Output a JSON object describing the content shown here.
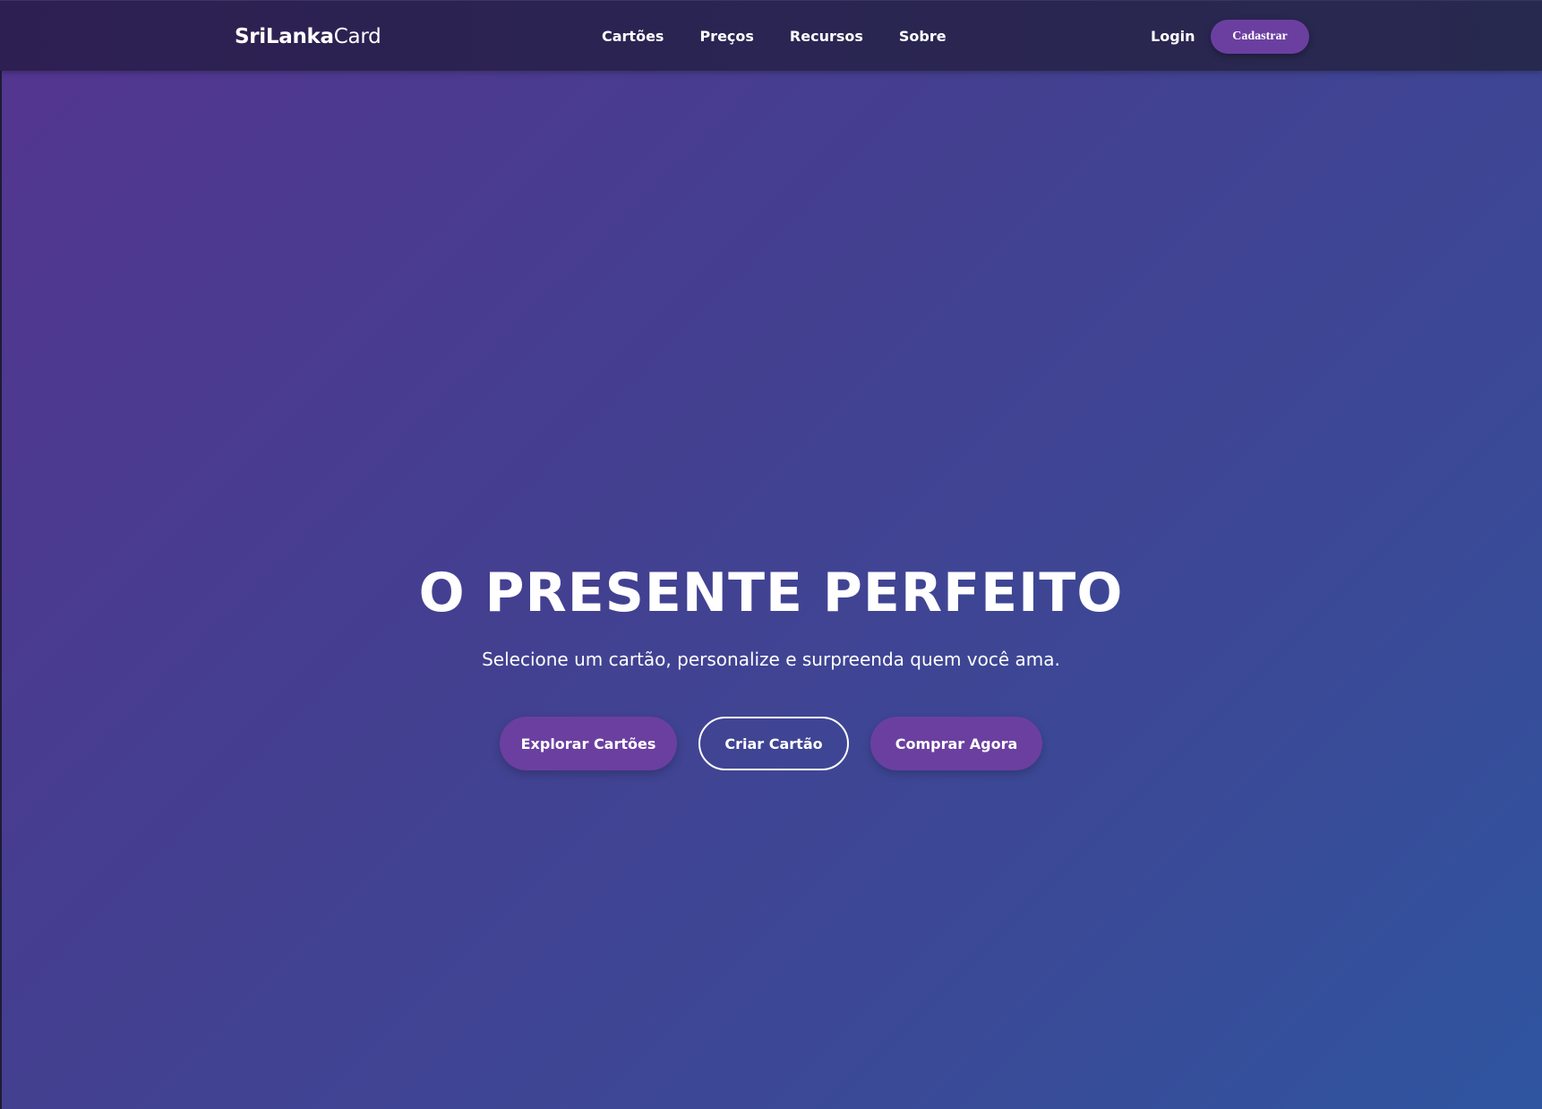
{
  "navbar": {
    "logo_bold": "SriLanka",
    "logo_light": "Card",
    "links": [
      "Cartões",
      "Preços",
      "Recursos",
      "Sobre"
    ],
    "login_label": "Login",
    "signup_label": "Cadastrar"
  },
  "hero": {
    "title": "O PRESENTE PERFEITO",
    "subtitle": "Selecione um cartão, personalize e surpreenda quem você ama.",
    "buttons": {
      "explore": "Explorar Cartões",
      "create": "Criar Cartão",
      "buy": "Comprar Agora"
    }
  },
  "colors": {
    "accent": "#6b3fa0",
    "navbar_bg": "#2a2552",
    "gradient_start": "#543590",
    "gradient_end": "#2f55a0"
  }
}
